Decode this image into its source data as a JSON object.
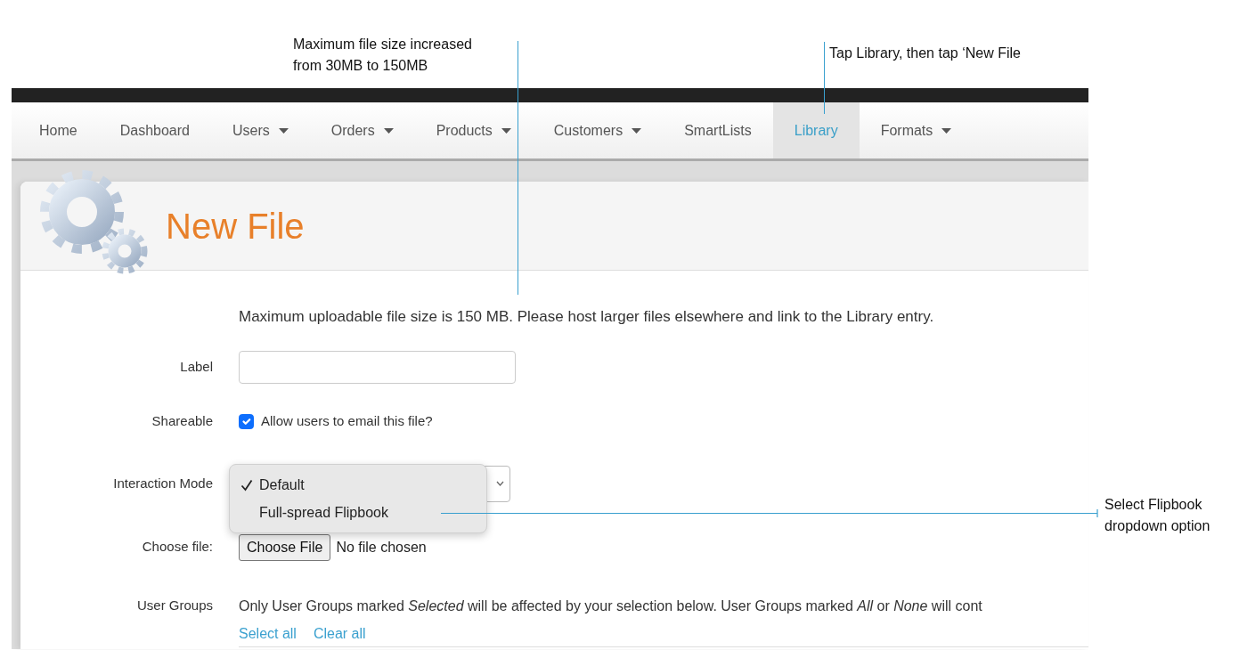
{
  "annotations": [
    {
      "lines": [
        "Maximum file size increased",
        "from 30MB to 150MB"
      ]
    },
    {
      "lines": [
        "Tap Library, then tap ‘New File"
      ]
    },
    {
      "lines": [
        "Select Flipbook",
        "dropdown option"
      ]
    }
  ],
  "nav": [
    {
      "label": "Home",
      "dropdown": false,
      "selected": false
    },
    {
      "label": "Dashboard",
      "dropdown": false,
      "selected": false
    },
    {
      "label": "Users",
      "dropdown": true,
      "selected": false
    },
    {
      "label": "Orders",
      "dropdown": true,
      "selected": false
    },
    {
      "label": "Products",
      "dropdown": true,
      "selected": false
    },
    {
      "label": "Customers",
      "dropdown": true,
      "selected": false
    },
    {
      "label": "SmartLists",
      "dropdown": false,
      "selected": false
    },
    {
      "label": "Library",
      "dropdown": false,
      "selected": true
    },
    {
      "label": "Formats",
      "dropdown": true,
      "selected": false
    }
  ],
  "page": {
    "title": "New File",
    "notice": "Maximum uploadable file size is 150 MB. Please host larger files elsewhere and link to the Library entry."
  },
  "form": [
    {
      "kind": "text",
      "label": "Label"
    },
    {
      "kind": "checkbox",
      "label": "Shareable",
      "text": "Allow users to email this file?",
      "checked": true
    },
    {
      "kind": "select",
      "label": "Interaction Mode",
      "expanded": true,
      "options": [
        {
          "label": "Default",
          "selected": true
        },
        {
          "label": "Full-spread Flipbook",
          "selected": false
        }
      ]
    },
    {
      "kind": "file",
      "label": "Choose file:",
      "button": "Choose File",
      "status": "No file chosen"
    },
    {
      "kind": "groups",
      "label": "User Groups",
      "text": "Only User Groups marked *Selected* will be affected by your selection below. User Groups marked *All* or *None* will cont",
      "links": [
        "Select all",
        "Clear all"
      ]
    }
  ]
}
